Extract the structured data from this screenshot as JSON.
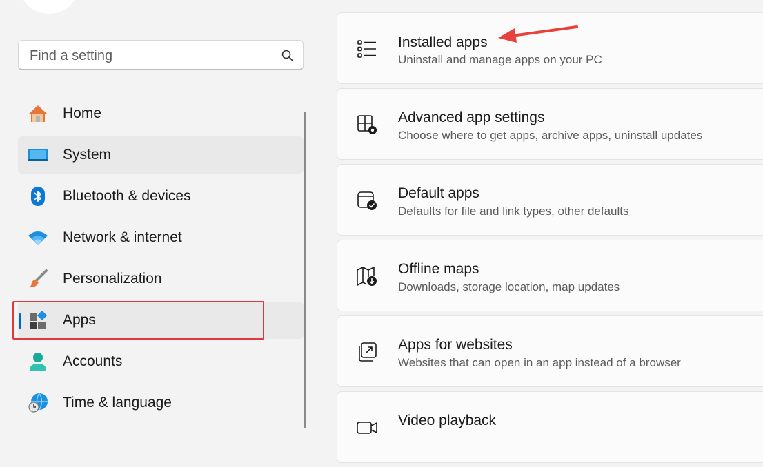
{
  "search": {
    "placeholder": "Find a setting"
  },
  "nav": {
    "items": [
      {
        "label": "Home",
        "icon": "home-icon"
      },
      {
        "label": "System",
        "icon": "monitor-icon"
      },
      {
        "label": "Bluetooth & devices",
        "icon": "bluetooth-icon"
      },
      {
        "label": "Network & internet",
        "icon": "wifi-icon"
      },
      {
        "label": "Personalization",
        "icon": "brush-icon"
      },
      {
        "label": "Apps",
        "icon": "apps-icon",
        "selected": true
      },
      {
        "label": "Accounts",
        "icon": "person-icon"
      },
      {
        "label": "Time & language",
        "icon": "globe-clock-icon"
      }
    ]
  },
  "cards": [
    {
      "title": "Installed apps",
      "desc": "Uninstall and manage apps on your PC",
      "icon": "list-icon"
    },
    {
      "title": "Advanced app settings",
      "desc": "Choose where to get apps, archive apps, uninstall updates",
      "icon": "app-settings-icon"
    },
    {
      "title": "Default apps",
      "desc": "Defaults for file and link types, other defaults",
      "icon": "default-apps-icon"
    },
    {
      "title": "Offline maps",
      "desc": "Downloads, storage location, map updates",
      "icon": "map-download-icon"
    },
    {
      "title": "Apps for websites",
      "desc": "Websites that can open in an app instead of a browser",
      "icon": "open-in-app-icon"
    },
    {
      "title": "Video playback",
      "desc": "",
      "icon": "video-icon"
    }
  ],
  "colors": {
    "accent": "#0067c0",
    "highlight": "#e0383e"
  }
}
